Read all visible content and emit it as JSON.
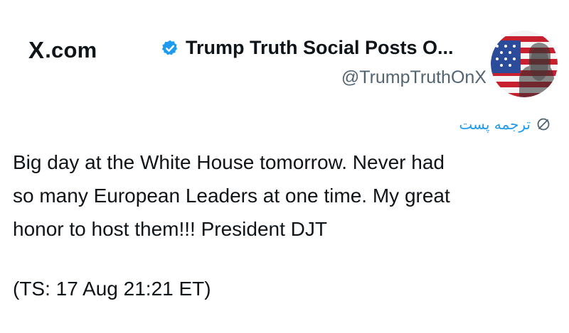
{
  "header": {
    "brand": ".com",
    "brand_mark": "X",
    "display_name": "Trump Truth Social Posts O...",
    "handle": "@TrumpTruthOnX",
    "verified_icon": "verified-badge-icon",
    "avatar": "avatar-american-flag-portrait"
  },
  "translate": {
    "label": "ترجمه پست",
    "icon": "translate-globe-icon"
  },
  "post": {
    "text": "Big day at the White House tomorrow. Never had\nso many European Leaders at one time. My great\nhonor to host them!!! President DJT",
    "timestamp": "(TS: 17 Aug 21:21 ET)"
  },
  "colors": {
    "accent": "#1d9bf0",
    "text": "#0f1419",
    "muted": "#536471"
  }
}
